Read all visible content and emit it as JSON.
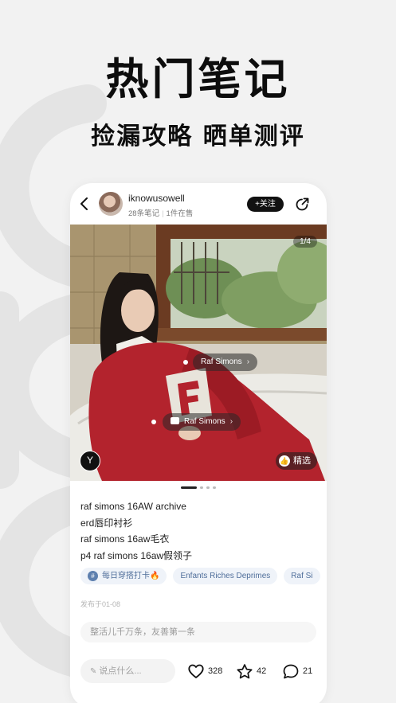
{
  "promo": {
    "headline": "热门笔记",
    "subline": "捡漏攻略  晒单测评"
  },
  "post": {
    "author": {
      "name": "iknowusowell",
      "notes": "28条笔记",
      "on_sale": "1件在售"
    },
    "follow_label": "+关注",
    "image": {
      "counter": "1/4",
      "tags": [
        "Raf Simons",
        "Raf Simons"
      ],
      "featured_label": "精选",
      "page_count": 4,
      "active_page": 1
    },
    "caption_lines": [
      "raf simons 16AW archive",
      "erd唇印衬衫",
      "raf simons 16aw毛衣",
      "p4 raf simons 16aw假领子"
    ],
    "chips": [
      "每日穿搭打卡🔥",
      "Enfants Riches Deprimes",
      "Raf Si"
    ],
    "posted": "发布于01-08",
    "comment_placeholder": "整活儿千万条，友善第一条",
    "say_placeholder": "说点什么...",
    "likes": "328",
    "stars": "42",
    "comments": "21"
  },
  "colors": {
    "background": "#f2f2f2",
    "chip_text": "#4f6e9a",
    "chip_bg": "#eff3f9",
    "sweater_red": "#b3232d"
  },
  "icons": [
    "back-icon",
    "share-icon",
    "brand-icon",
    "thumbs-up-icon",
    "heart-icon",
    "star-icon",
    "comment-icon",
    "pencil-icon",
    "hashtag-icon",
    "bag-icon"
  ]
}
